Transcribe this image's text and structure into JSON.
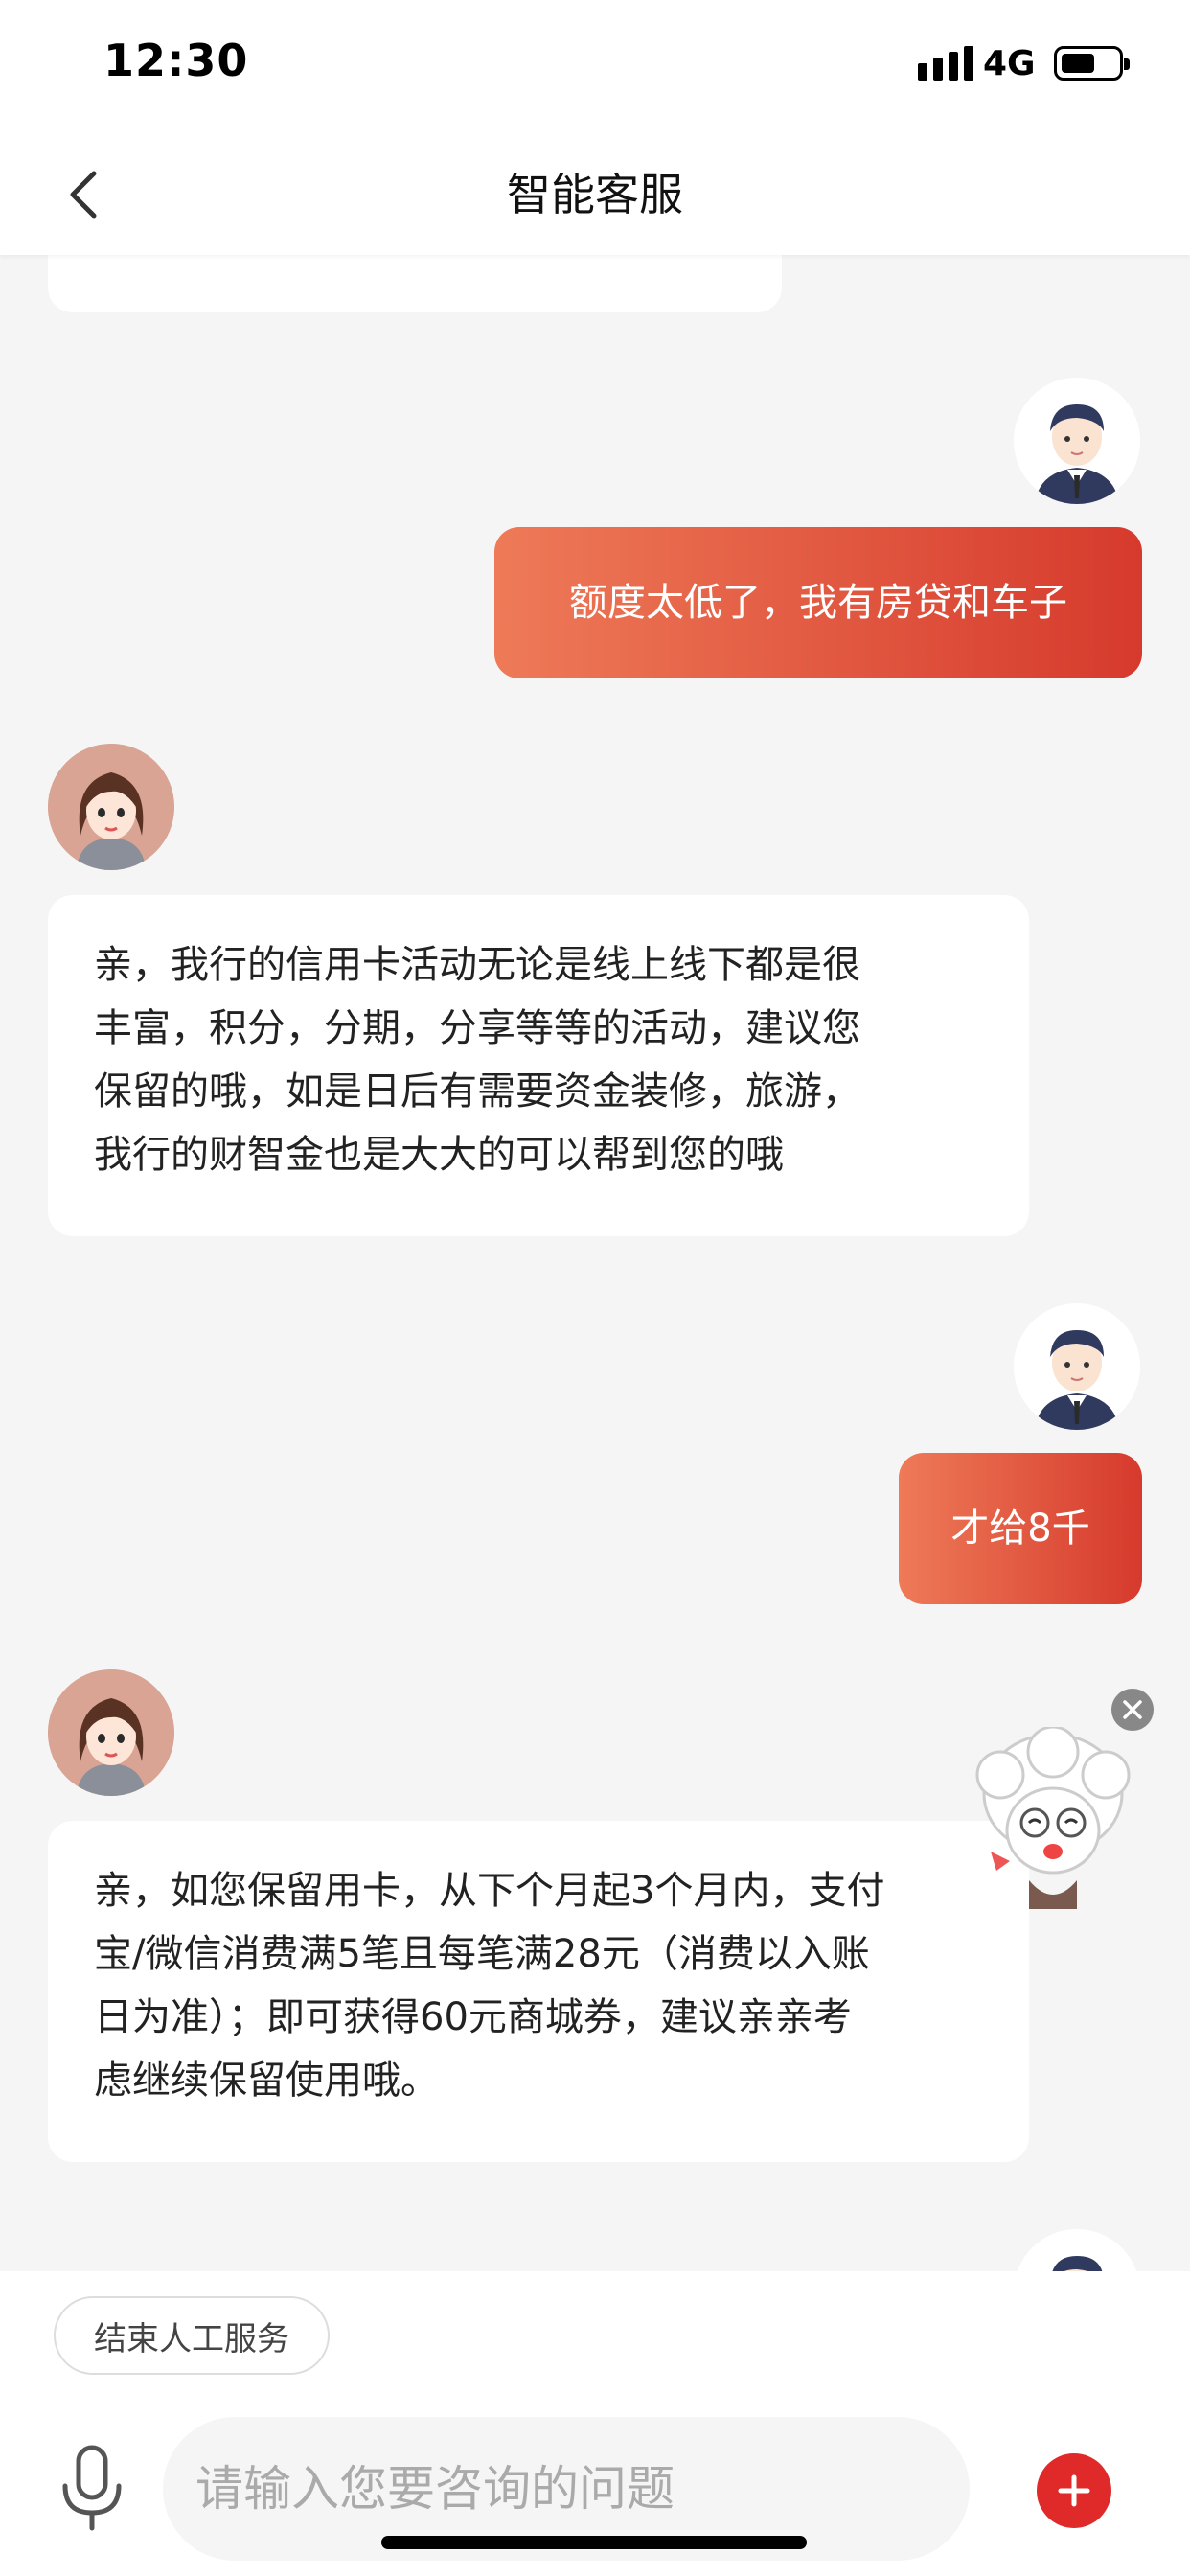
{
  "status_bar": {
    "time": "12:30",
    "network": "4G"
  },
  "header": {
    "title": "智能客服"
  },
  "messages": [
    {
      "role": "user",
      "text": "额度太低了，我有房贷和车子"
    },
    {
      "role": "bot",
      "lines": [
        "亲，我行的信用卡活动无论是线上线下都是很",
        "丰富，积分，分期，分享等等的活动，建议您",
        "保留的哦，如是日后有需要资金装修，旅游，",
        "我行的财智金也是大大的可以帮到您的哦"
      ]
    },
    {
      "role": "user",
      "text": "才给8千"
    },
    {
      "role": "bot",
      "lines": [
        "亲，如您保留用卡，从下个月起3个月内，支付",
        "宝/微信消费满5笔且每笔满28元（消费以入账",
        "日为准）；即可获得60元商城券，建议亲亲考",
        "虑继续保留使用哦。"
      ]
    }
  ],
  "bottom_bar": {
    "end_service_label": "结束人工服务",
    "input_placeholder": "请输入您要咨询的问题"
  },
  "colors": {
    "accent_red": "#e02a2a",
    "user_bubble_start": "#ee7a58",
    "user_bubble_end": "#d63a2c"
  },
  "icons": {
    "back": "chevron-left-icon",
    "mic": "microphone-icon",
    "plus": "plus-icon",
    "close": "close-icon"
  }
}
